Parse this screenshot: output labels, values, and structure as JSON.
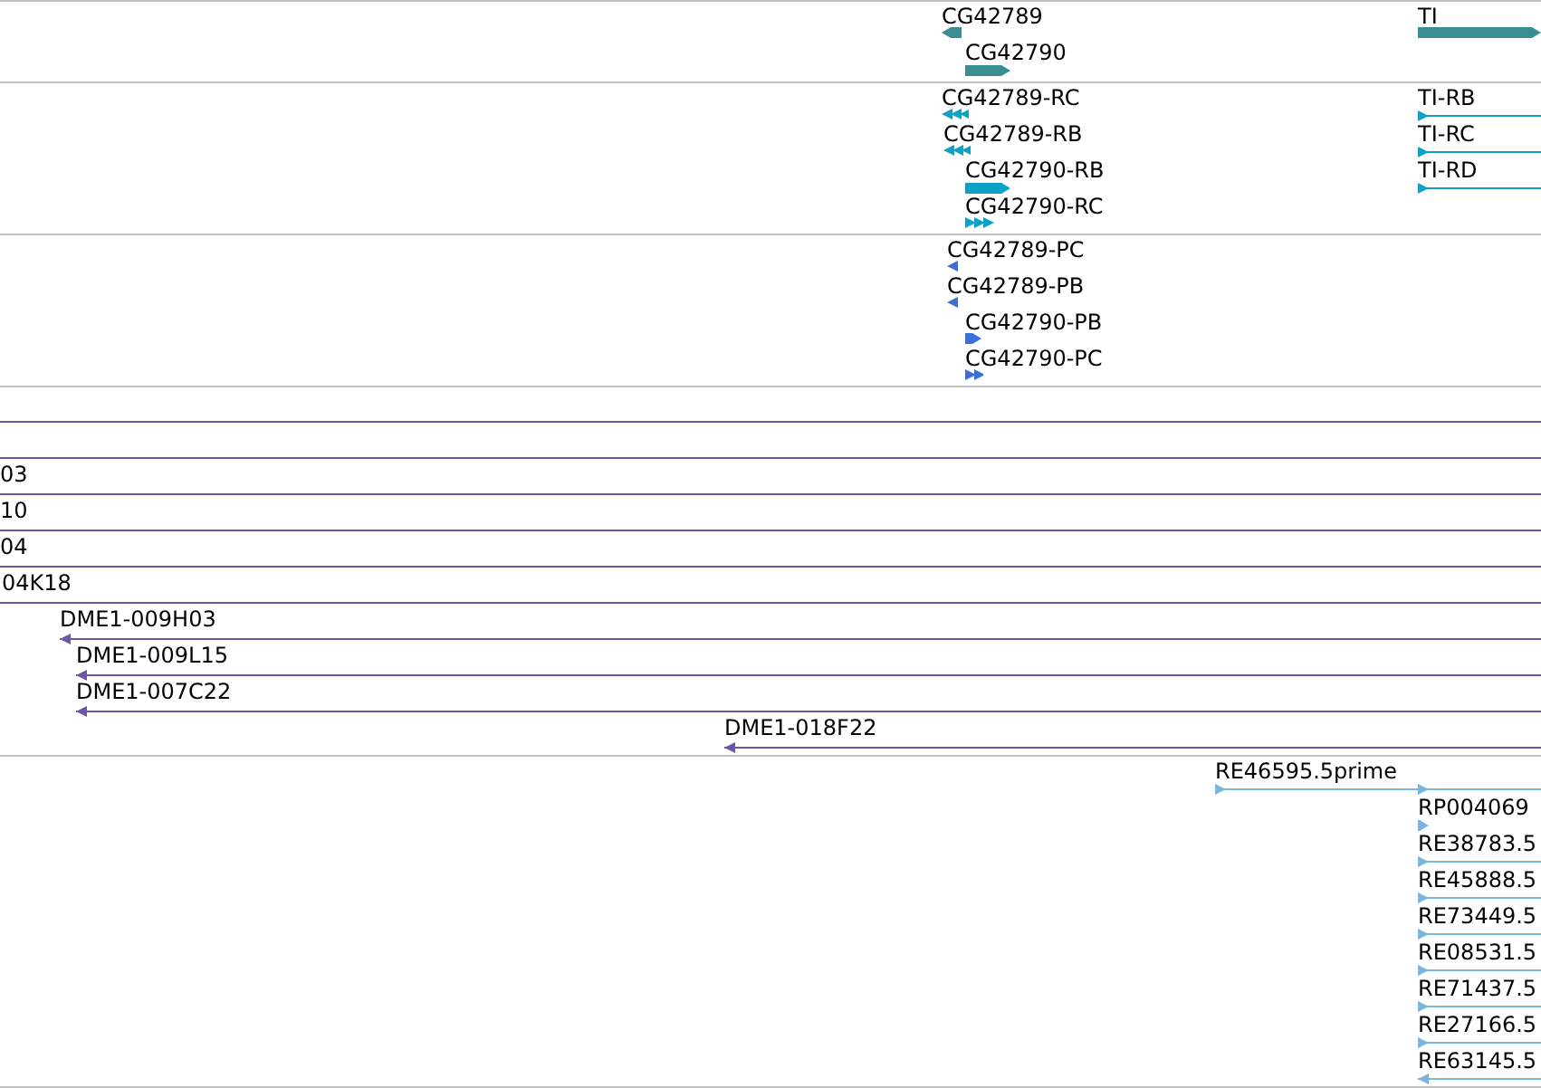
{
  "tracks": [
    {
      "color": "#3a8d90",
      "features": [
        {
          "label": "CG42789",
          "kind": "block",
          "reverse": true
        },
        {
          "label": "CG42790",
          "kind": "block",
          "reverse": false
        },
        {
          "label": "TI",
          "kind": "block",
          "reverse": false
        }
      ]
    },
    {
      "color": "#0ea1c6",
      "features": [
        {
          "label": "CG42789-RC",
          "kind": "chevrons",
          "reverse": true
        },
        {
          "label": "CG42789-RB",
          "kind": "chevrons",
          "reverse": true
        },
        {
          "label": "CG42790-RB",
          "kind": "block",
          "reverse": false
        },
        {
          "label": "CG42790-RC",
          "kind": "chevrons",
          "reverse": false
        },
        {
          "label": "TI-RB",
          "kind": "line",
          "reverse": false
        },
        {
          "label": "TI-RC",
          "kind": "line",
          "reverse": false
        },
        {
          "label": "TI-RD",
          "kind": "line",
          "reverse": false
        }
      ]
    },
    {
      "color": "#3a6fd6",
      "features": [
        {
          "label": "CG42789-PC",
          "kind": "chevrons",
          "reverse": true
        },
        {
          "label": "CG42789-PB",
          "kind": "chevrons",
          "reverse": true
        },
        {
          "label": "CG42790-PB",
          "kind": "block",
          "reverse": false
        },
        {
          "label": "CG42790-PC",
          "kind": "chevrons",
          "reverse": false
        }
      ]
    },
    {
      "color": "#6e55aa",
      "features": [
        {
          "kind": "edge"
        },
        {
          "kind": "edge"
        },
        {
          "label": "03",
          "kind": "edge"
        },
        {
          "label": "10",
          "kind": "edge"
        },
        {
          "label": "04",
          "kind": "edge"
        },
        {
          "label": "04K18",
          "kind": "edge"
        },
        {
          "label": "DME1-009H03",
          "kind": "line",
          "reverse": true
        },
        {
          "label": "DME1-009L15",
          "kind": "line",
          "reverse": true
        },
        {
          "label": "DME1-007C22",
          "kind": "line",
          "reverse": true
        },
        {
          "label": "DME1-018F22",
          "kind": "line",
          "reverse": true
        }
      ]
    },
    {
      "color": "#7ab4e0",
      "features": [
        {
          "label": "RE46595.5prime",
          "kind": "line",
          "reverse": false
        },
        {
          "label": "RP004069",
          "kind": "block",
          "reverse": false
        },
        {
          "label": "RE38783.5",
          "kind": "line",
          "reverse": false
        },
        {
          "label": "RE45888.5",
          "kind": "line",
          "reverse": false
        },
        {
          "label": "RE73449.5",
          "kind": "line",
          "reverse": false
        },
        {
          "label": "RE08531.5",
          "kind": "line",
          "reverse": false
        },
        {
          "label": "RE71437.5",
          "kind": "line",
          "reverse": false
        },
        {
          "label": "RE27166.5",
          "kind": "line",
          "reverse": false
        },
        {
          "label": "RE63145.5",
          "kind": "line",
          "reverse": true
        }
      ]
    }
  ]
}
